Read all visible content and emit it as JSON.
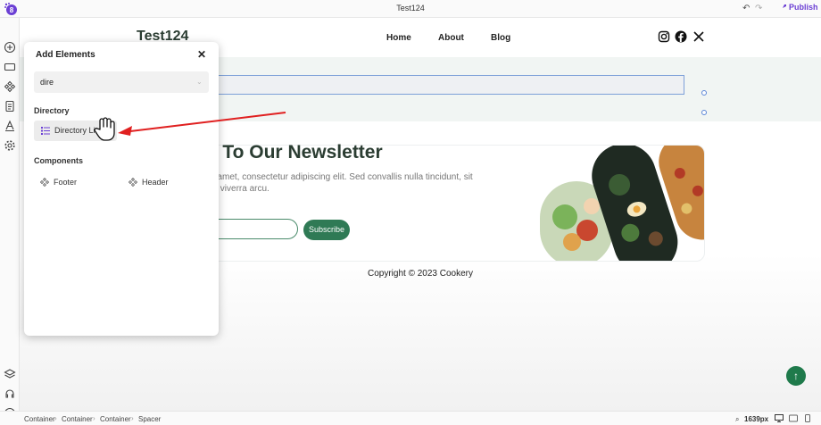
{
  "app": {
    "title": "Test124",
    "publish_label": "Publish",
    "accent": "#6b3fd4"
  },
  "site": {
    "brand": "Test124",
    "nav": [
      "Home",
      "About",
      "Blog"
    ],
    "social_icons": [
      "instagram-icon",
      "facebook-icon",
      "x-icon"
    ],
    "newsletter_title": "be To Our Newsletter",
    "newsletter_text": "or sit amet, consectetur adipiscing elit. Sed convallis nulla tincidunt, sit amet, viverra arcu.",
    "email_placeholder": "l",
    "subscribe_label": "Subscribe",
    "copyright": "Copyright © 2023 Cookery",
    "brand_color": "#2f7a55"
  },
  "panel": {
    "title": "Add Elements",
    "search_value": "dire",
    "sections": {
      "directory": {
        "label": "Directory",
        "items": [
          "Directory List"
        ]
      },
      "components": {
        "label": "Components",
        "items": [
          "Footer",
          "Header"
        ]
      }
    }
  },
  "bottombar": {
    "breadcrumb": [
      "Container",
      "Container",
      "Container",
      "Spacer"
    ],
    "zoom": "1639px"
  }
}
